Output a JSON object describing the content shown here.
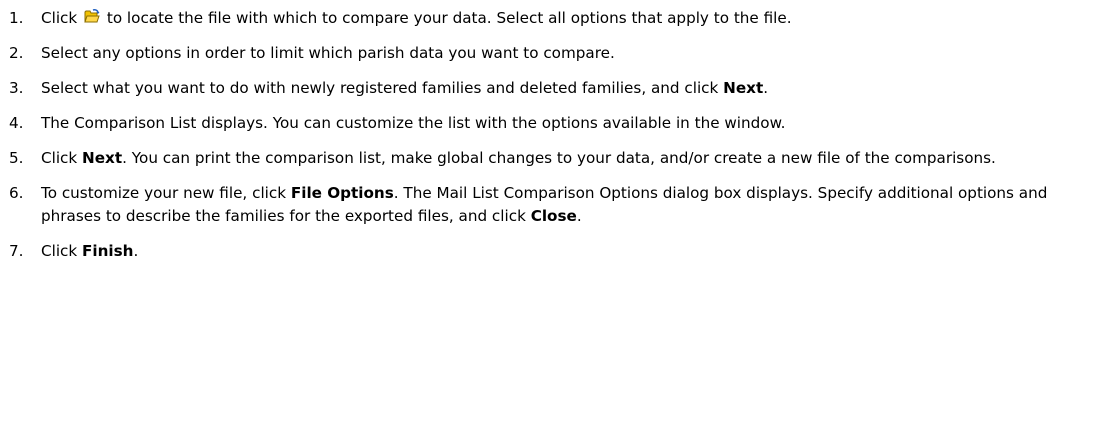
{
  "steps": [
    {
      "number": "1.",
      "pre": "Click",
      "icon": "open-folder-icon",
      "post": "to locate the file with which to compare your data. Select all options that apply to the file."
    },
    {
      "number": "2.",
      "text": "Select any options in order to limit which parish data you want to compare."
    },
    {
      "number": "3.",
      "pre": "Select what you want to do with newly registered families and deleted families, and click",
      "bold": "Next",
      "post": "."
    },
    {
      "number": "4.",
      "text": "The Comparison List displays. You can customize the list with the options available in the window."
    },
    {
      "number": "5.",
      "pre": "Click",
      "bold": "Next",
      "post": ". You can print the comparison list, make global changes to your data, and/or create a new file of the comparisons."
    },
    {
      "number": "6.",
      "pre": "To customize your new file, click",
      "bold": "File Options",
      "mid": ". The Mail List Comparison Options dialog box displays. Specify additional options and phrases to describe the families for the exported files, and click",
      "bold2": "Close",
      "post": "."
    },
    {
      "number": "7.",
      "pre": "Click",
      "bold": "Finish",
      "post": "."
    }
  ],
  "colors": {
    "folder_body": "#f2c200",
    "folder_outline": "#8a6d00",
    "folder_arrow": "#1f5fc0"
  }
}
